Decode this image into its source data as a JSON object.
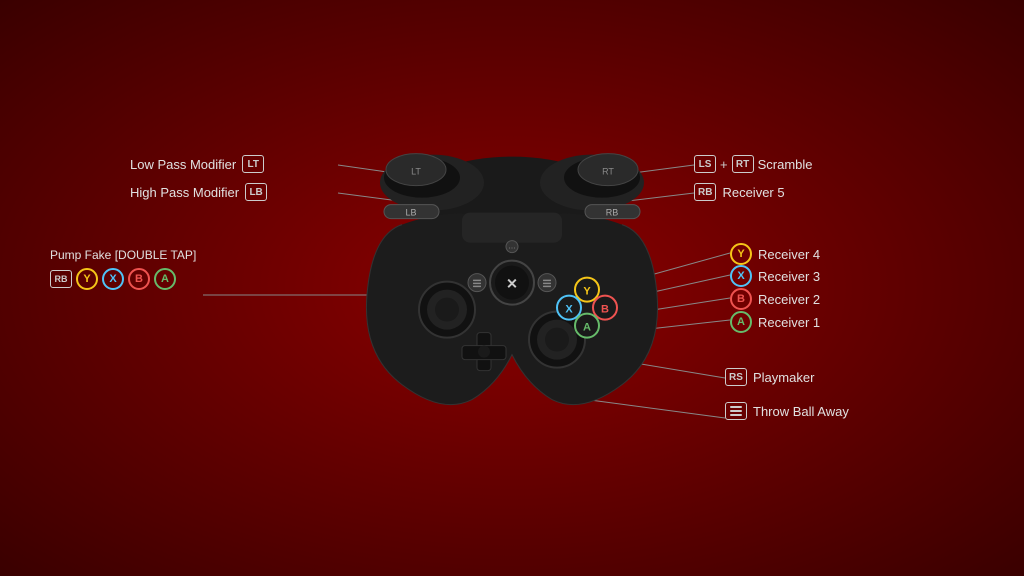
{
  "background_color": "#7a0000",
  "labels": {
    "low_pass_modifier": "Low Pass Modifier",
    "high_pass_modifier": "High Pass Modifier",
    "scramble": "Scramble",
    "receiver5": "Receiver 5",
    "receiver4": "Receiver 4",
    "receiver3": "Receiver 3",
    "receiver2": "Receiver 2",
    "receiver1": "Receiver 1",
    "playmaker": "Playmaker",
    "throw_ball_away": "Throw Ball Away",
    "pump_fake": "Pump Fake [DOUBLE TAP]"
  },
  "buttons": {
    "lt": "LT",
    "lb": "LB",
    "ls": "LS",
    "rt": "RT",
    "rb": "RB",
    "rs": "RS",
    "y": "Y",
    "x": "X",
    "b": "B",
    "a": "A"
  }
}
